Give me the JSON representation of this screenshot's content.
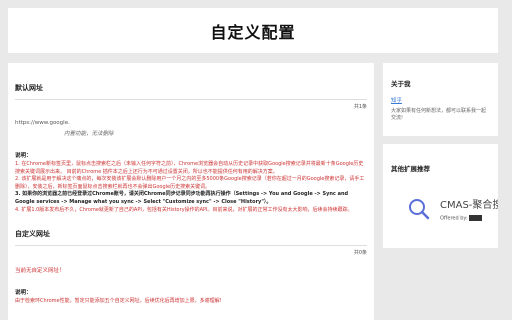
{
  "page_title": "自定义配置",
  "default_url": {
    "title": "默认网址",
    "count": "共1条",
    "url": "https://www.google.",
    "description": "内置功能，无法删除",
    "note_label": "说明：",
    "notes": [
      "1. 在Chrome新标签页里，鼠标点击搜索栏之后（未输入任何字符之前），Chrome浏览器会自动从历史记录中获取Google搜索记录并将最新十条Google历史搜索关键词展示出来。 目前的Chrome 插件本之后上还行为不可通过设置关闭，所以也不能提供任何有用的解决方案。",
      "2. 该扩展就是用于解决这个痛点的，每次安装该扩展会默认删除用户一个月之内的至多5000条Google搜索记录（若你在超过一月的Google搜索记录，请手工删除），安装之后，新标签页面鼠标点击搜索栏就再也不会弹出Google历史搜索关键词。",
      "3. 如果你的浏览器之前已经登录过Chrome账号，请关闭Chrome同步记录同步功能再执行操作（Settings -> You and Google -> Sync and Google services -> Manage what you sync -> Select \"Customize sync\" -> Close \"History\"）。",
      "4. 扩展1.0版本发布后不久，Chrome就更新了自己的API，包括有关History操作的API。目前来说，对扩展的正常工作没有太大影响，后续会持续跟踪。"
    ]
  },
  "custom_url": {
    "title": "自定义网址",
    "count": "共0条",
    "empty_text": "当前无自定义网址！",
    "note_label": "说明：",
    "note": "由于检索环Chrome性能，暂定只能添加五个自定义网址，后续优化后再增加上限，多谢理解!"
  },
  "about": {
    "title": "关于我",
    "link": "知乎",
    "text": "大家如果有任何新想法，都可以联系我一起交流!"
  },
  "other_ext": {
    "title": "其他扩展推荐",
    "name": "CMAS-聚合搜",
    "offered_by": "Offered by:",
    "icon": "search-icon",
    "icon_color": "#5b6fd8"
  }
}
